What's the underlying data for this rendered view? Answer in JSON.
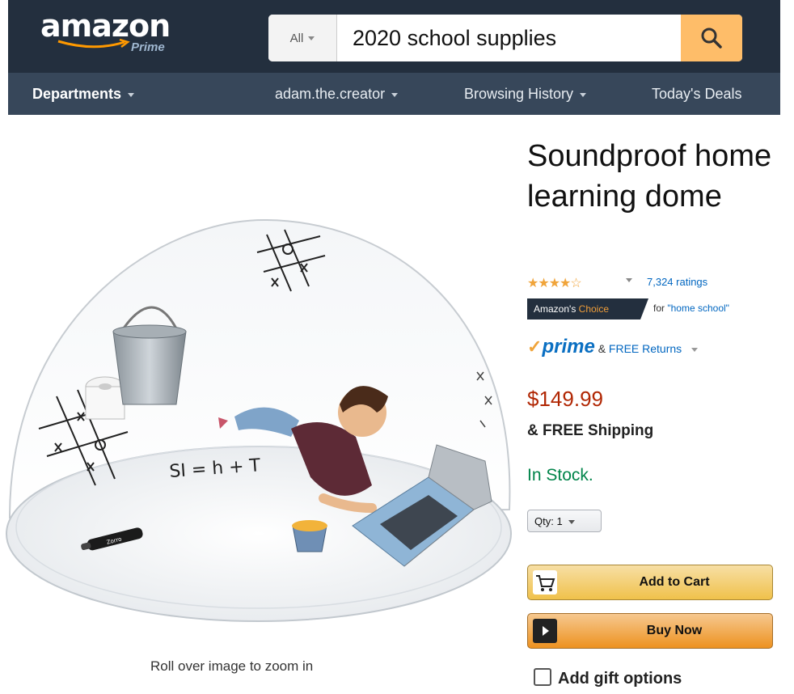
{
  "header": {
    "logo_text": "amazon",
    "logo_sub": "Prime",
    "search": {
      "category": "All",
      "query": "2020 school supplies",
      "button_icon": "search-icon"
    },
    "nav": {
      "departments": "Departments",
      "account": "adam.the.creator",
      "history": "Browsing History",
      "deals": "Today's Deals"
    }
  },
  "product": {
    "title": "Soundproof home learning dome",
    "rating_stars": 4.5,
    "ratings_count": "7,324 ratings",
    "badge": {
      "prefix": "Amazon's",
      "label": "Choice",
      "for_text": "for",
      "keyword": "\"home school\""
    },
    "prime": {
      "check": "✓",
      "word": "prime",
      "amp": "&",
      "returns": "FREE Returns"
    },
    "price": "$149.99",
    "shipping": "& FREE Shipping",
    "availability": "In Stock.",
    "qty": {
      "label": "Qty:",
      "value": "1"
    },
    "add_to_cart": "Add to Cart",
    "buy_now": "Buy Now",
    "gift_options": "Add gift options"
  },
  "image": {
    "zoom_hint": "Roll over image to zoom in",
    "equation": "SI = h + T",
    "marker_label": "Zorro"
  },
  "colors": {
    "header_bg": "#232f3e",
    "nav_bg": "#37475a",
    "search_button": "#febd69",
    "price": "#b12704",
    "in_stock": "#00844a",
    "stars": "#f0a43a",
    "link": "#0066c0"
  }
}
